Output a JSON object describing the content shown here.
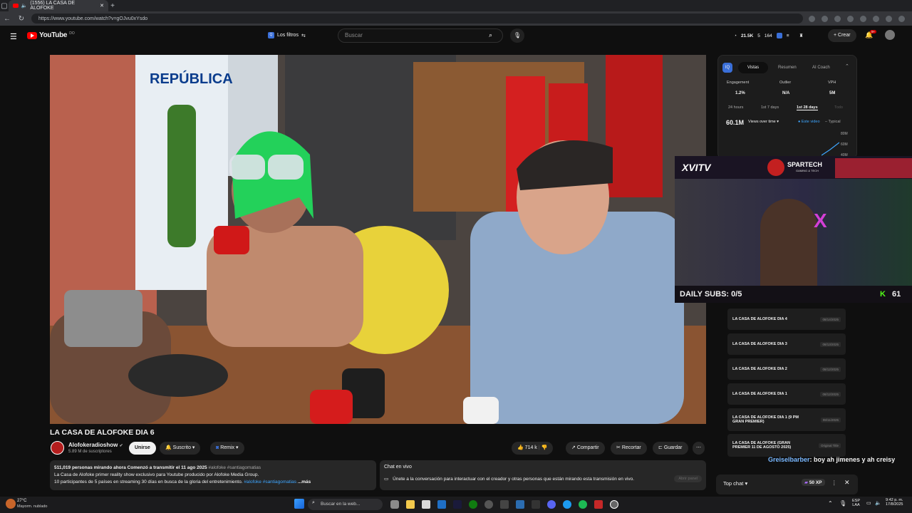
{
  "browser": {
    "tab_title": "(1556) LA CASA DE ALOFOKE",
    "url": "https://www.youtube.com/watch?v=gOJvu0xYsdo"
  },
  "header": {
    "logo_text": "YouTube",
    "logo_suffix": "DO",
    "filters_label": "Los filtros",
    "search_placeholder": "Buscar",
    "stat_views": "21.5K",
    "stat_a": "5",
    "stat_b": "164",
    "create_label": "Crear",
    "notif_count": "9+"
  },
  "insights": {
    "tabs": [
      "Vistas",
      "Resumen",
      "AI Coach"
    ],
    "metric_labels": [
      "Engagement",
      "Outlier",
      "VPH"
    ],
    "metric_values": [
      "1.2%",
      "N/A",
      "5M"
    ],
    "ranges": [
      "24 hours",
      "1st 7 days",
      "1st 28 days",
      "Todo"
    ],
    "total": "60.1M",
    "dropdown": "Views over time",
    "legend_a": "Este video",
    "legend_b": "Typical",
    "yticks": [
      "80M",
      "60M",
      "40M"
    ]
  },
  "overlay": {
    "brand_left": "XVITV",
    "brand_right": "SPARTECH",
    "brand_right_sub": "GAMING & TECH",
    "daily_subs": "DAILY SUBS: 0/5",
    "kick_count": "61",
    "chat_user": "Greiselbarber",
    "chat_msg": ": boy ah jimenes y ah creisy"
  },
  "playlist": [
    {
      "title": "LA CASA DE ALOFOKE DIA 4",
      "date": "08/14/2025"
    },
    {
      "title": "LA CASA DE ALOFOKE DIA 3",
      "date": "08/13/2025"
    },
    {
      "title": "LA CASA DE ALOFOKE DIA 2",
      "date": "08/12/2025"
    },
    {
      "title": "LA CASA DE ALOFOKE DIA 1",
      "date": "08/12/2025"
    },
    {
      "title": "LA CASA DE ALOFOKE DIA 1 (9 PM GRAN PREMIER)",
      "date": "08/11/2025"
    },
    {
      "title": "LA CASA DE ALOFOKE (GRAN PREMIER 11 DE AGOSTO 2025)",
      "date": "Original Title"
    }
  ],
  "video": {
    "title": "LA CASA DE ALOFOKE DIA 6",
    "channel": "Alofokeradioshow",
    "subs": "5.89 M de suscriptores",
    "join": "Unirse",
    "subscribed": "Suscrito",
    "remix": "Remix",
    "likes": "714 k",
    "share": "Compartir",
    "clip": "Recortar",
    "save": "Guardar"
  },
  "description": {
    "line1_bold": "511,019 personas mirando ahora  Comenzó a transmitir el 11 ago 2025",
    "line1_tags": " #alofoke #santiagomatias",
    "line2": "La Casa de Alofoke primer reality show exclusivo para Youtube producido por Alofoke Media Group.",
    "line3": "10 participantes de 5 países en streaming 30 días en busca de la gloria del entretenimiento.",
    "line3_tags": " #alofoke #santiagomatias",
    "more": "...más"
  },
  "chat": {
    "title": "Chat en vivo",
    "text": "Únete a la conversación para interactuar con el creador y otras personas que están mirando esta transmisión en vivo.",
    "button": "Abrir panel",
    "top_chat": "Top chat",
    "xp": "50 XP"
  },
  "taskbar": {
    "temp": "27°C",
    "weather": "Mayorm. nublado",
    "search": "Buscar en la web...",
    "lang": "ESP",
    "lang2": "LAA",
    "time": "9:42 p. m.",
    "date": "17/8/2025"
  },
  "colors": {
    "accent": "#ff0000",
    "bg": "#0f0f0f",
    "link": "#3ea6ff"
  }
}
